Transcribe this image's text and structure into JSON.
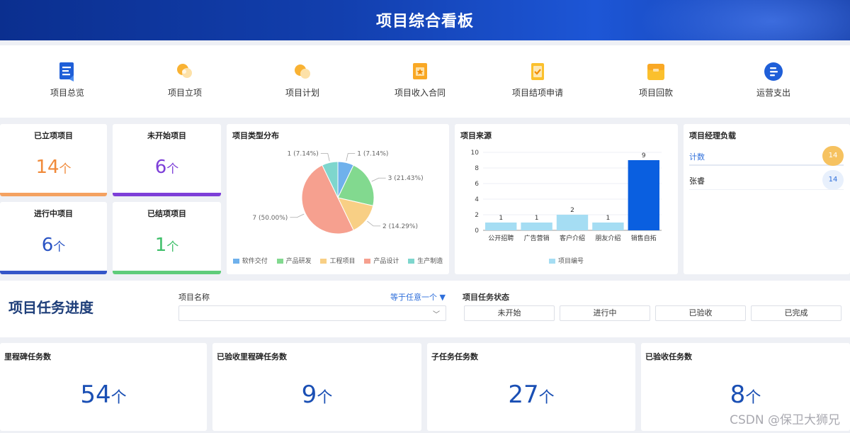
{
  "header": {
    "title": "项目综合看板"
  },
  "nav": [
    {
      "label": "项目总览",
      "icon": "document-icon"
    },
    {
      "label": "项目立项",
      "icon": "sun-cloud-icon"
    },
    {
      "label": "项目计划",
      "icon": "planet-icon"
    },
    {
      "label": "项目收入合同",
      "icon": "contract-icon"
    },
    {
      "label": "项目结项申请",
      "icon": "check-card-icon"
    },
    {
      "label": "项目回款",
      "icon": "wallet-icon"
    },
    {
      "label": "运营支出",
      "icon": "list-circle-icon"
    }
  ],
  "stats": {
    "established": {
      "title": "已立项项目",
      "value": "14",
      "unit": "个",
      "color": "#f08a3a"
    },
    "not_started": {
      "title": "未开始项目",
      "value": "6",
      "unit": "个",
      "color": "#7d3fd8"
    },
    "in_progress": {
      "title": "进行中项目",
      "value": "6",
      "unit": "个",
      "color": "#2a54c4"
    },
    "closed": {
      "title": "已结项项目",
      "value": "1",
      "unit": "个",
      "color": "#3fbf6a"
    }
  },
  "type_card": {
    "title": "项目类型分布"
  },
  "source_card": {
    "title": "项目来源"
  },
  "manager": {
    "title": "项目经理负载",
    "rows": [
      {
        "name": "计数",
        "count": "14"
      },
      {
        "name": "张睿",
        "count": "14"
      }
    ]
  },
  "filter": {
    "section_title": "项目任务进度",
    "name_label": "项目名称",
    "operator": "等于任意一个",
    "status_label": "项目任务状态",
    "statuses": [
      "未开始",
      "进行中",
      "已验收",
      "已完成"
    ]
  },
  "tasks": {
    "milestone": {
      "title": "里程碑任务数",
      "value": "54",
      "unit": "个"
    },
    "milestone_accepted": {
      "title": "已验收里程碑任务数",
      "value": "9",
      "unit": "个"
    },
    "subtask": {
      "title": "子任务任务数",
      "value": "27",
      "unit": "个"
    },
    "accepted": {
      "title": "已验收任务数",
      "value": "8",
      "unit": "个"
    }
  },
  "watermark": "CSDN @保卫大狮兄",
  "chart_data": [
    {
      "type": "pie",
      "categories": [
        "软件交付",
        "产品研发",
        "工程项目",
        "产品设计",
        "生产制造"
      ],
      "values": [
        1,
        3,
        2,
        7,
        1
      ],
      "labels": [
        "1 (7.14%)",
        "3 (21.43%)",
        "2 (14.29%)",
        "7 (50.00%)",
        "1 (7.14%)"
      ],
      "colors": [
        "#6fb1ec",
        "#82d98f",
        "#f8cf85",
        "#f6a08f",
        "#7ed6cd"
      ],
      "legend": "bottom"
    },
    {
      "type": "bar",
      "categories": [
        "公开招聘",
        "广告营销",
        "客户介绍",
        "朋友介绍",
        "销售自拓"
      ],
      "series": [
        {
          "name": "项目编号",
          "values": [
            1,
            1,
            2,
            1,
            9
          ]
        }
      ],
      "highlight_color": "#0a5fe0",
      "bar_color": "#a5ddf3",
      "yticks": [
        0,
        2,
        4,
        6,
        8,
        10
      ],
      "ylim": [
        0,
        10
      ],
      "legend": "bottom"
    }
  ]
}
